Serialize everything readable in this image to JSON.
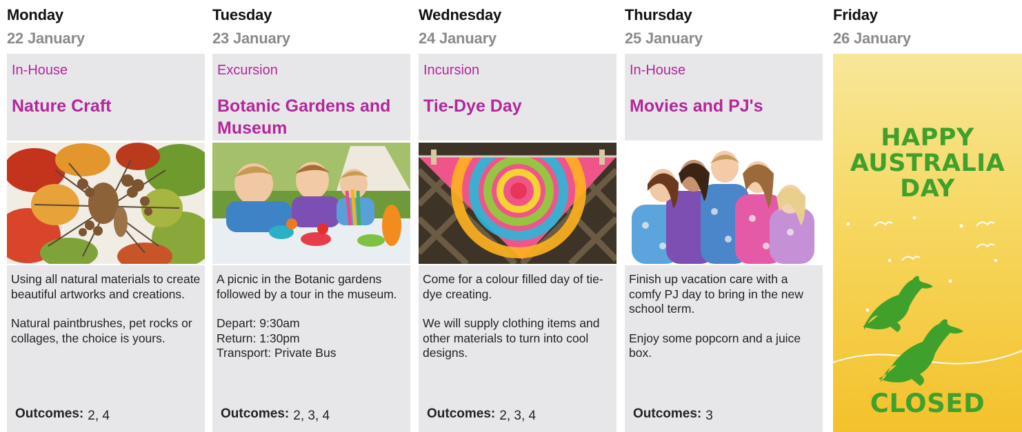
{
  "days": [
    {
      "name": "Monday",
      "date": "22 January",
      "category": "In-House",
      "title": "Nature Craft",
      "photo_icon": "autumn-leaves-pinecones-photo",
      "description": [
        "Using all natural materials to create beautiful artworks and creations.",
        "Natural paintbrushes, pet rocks or collages, the choice is yours."
      ],
      "outcomes_label": "Outcomes:",
      "outcomes_value": "2, 4"
    },
    {
      "name": "Tuesday",
      "date": "23 January",
      "category": "Excursion",
      "title": "Botanic Gardens and Museum",
      "photo_icon": "kids-picnic-photo",
      "description": [
        "A picnic in the Botanic gardens followed by a tour in the museum.",
        "Depart: 9:30am\nReturn: 1:30pm\nTransport: Private Bus"
      ],
      "outcomes_label": "Outcomes:",
      "outcomes_value": "2, 3, 4"
    },
    {
      "name": "Wednesday",
      "date": "24 January",
      "category": "Incursion",
      "title": "Tie-Dye Day",
      "photo_icon": "tie-dye-cloth-photo",
      "description": [
        "Come for a colour filled day of tie-dye creating.",
        "We will supply clothing items and other materials to turn into cool designs."
      ],
      "outcomes_label": "Outcomes:",
      "outcomes_value": "2, 3, 4"
    },
    {
      "name": "Thursday",
      "date": "25 January",
      "category": "In-House",
      "title": "Movies and PJ's",
      "photo_icon": "kids-in-pyjamas-photo",
      "description": [
        "Finish up vacation care with a comfy PJ day to bring in the new school term.",
        "Enjoy some popcorn and a juice box."
      ],
      "outcomes_label": "Outcomes:",
      "outcomes_value": "3"
    }
  ],
  "friday": {
    "name": "Friday",
    "date": "26 January",
    "banner_line1": "HAPPY",
    "banner_line2": "AUSTRALIA",
    "banner_line3": "DAY",
    "closed_text": "CLOSED",
    "icon": "kangaroo-icon"
  },
  "colors": {
    "accent": "#b3279a",
    "card_bg": "#e7e7ea",
    "aus_green": "#3fa12b",
    "aus_yellow": "#f4c12c"
  }
}
